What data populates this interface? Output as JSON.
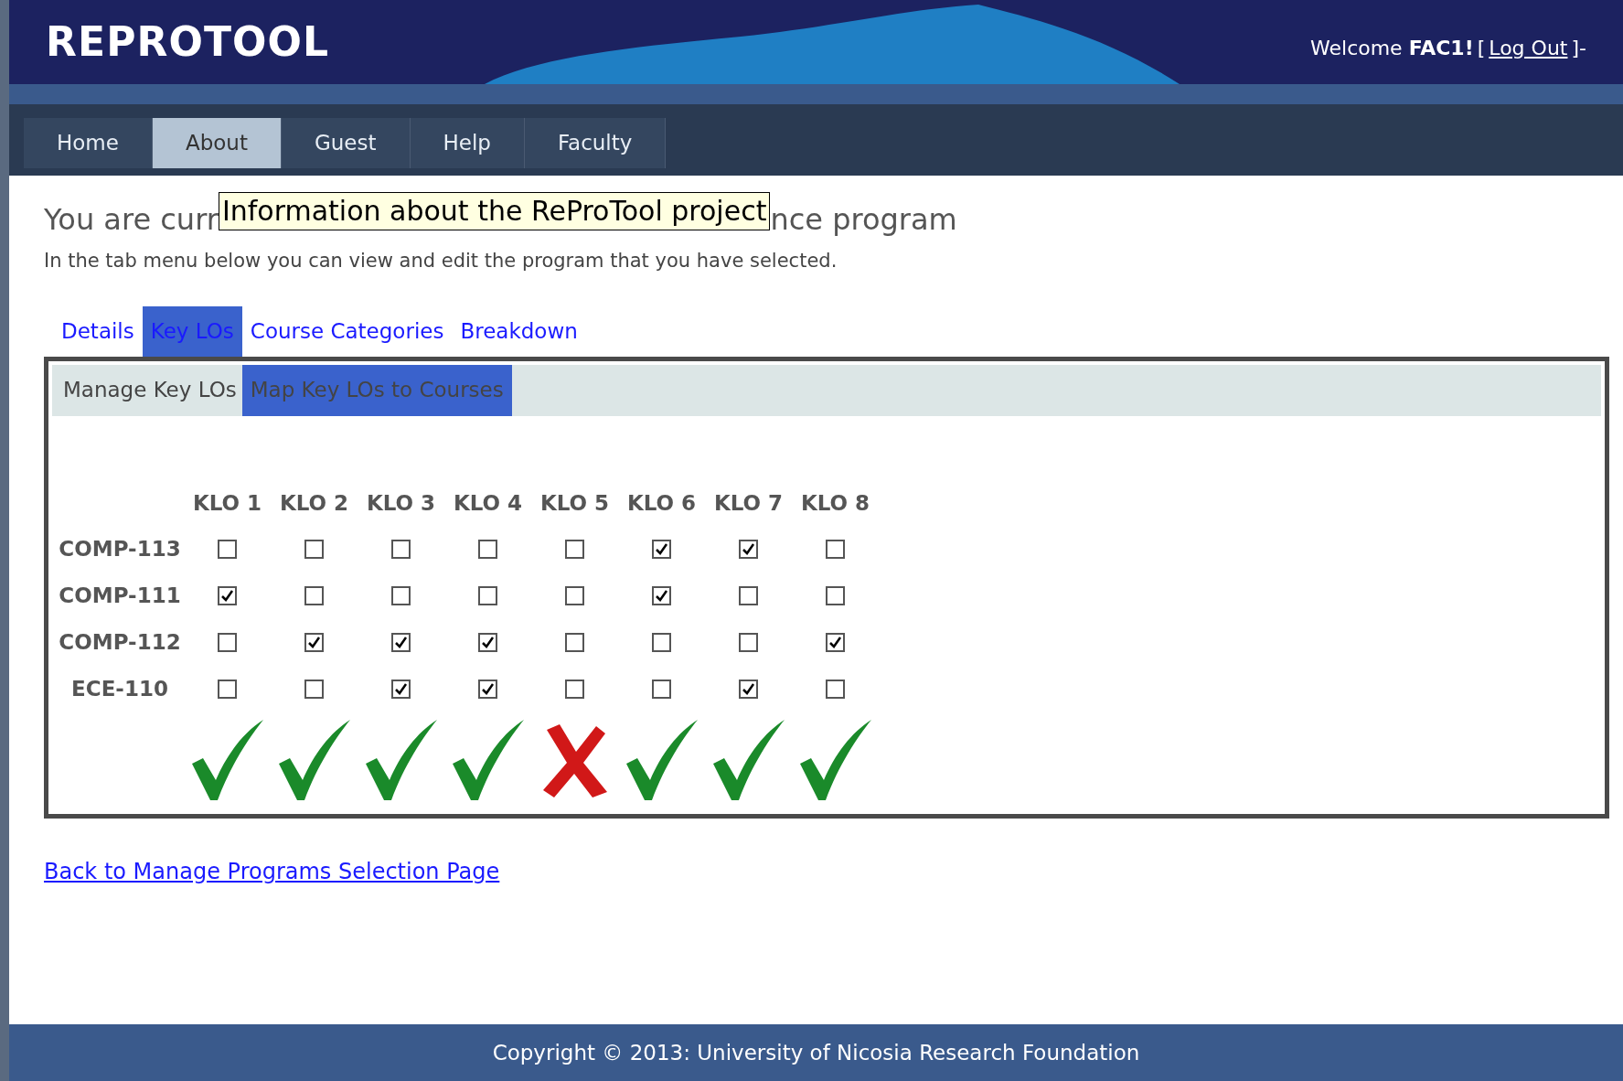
{
  "header": {
    "logo": "REPROTOOL",
    "welcome": "Welcome **FAC1!**",
    "logout_open": "[",
    "logout": "Log Out",
    "logout_close": "]-"
  },
  "nav": [
    {
      "label": "Home",
      "selected": false
    },
    {
      "label": "About",
      "selected": true
    },
    {
      "label": "Guest",
      "selected": false
    },
    {
      "label": "Help",
      "selected": false
    },
    {
      "label": "Faculty",
      "selected": false
    }
  ],
  "tooltip": "Information about the ReProTool project",
  "heading_start": "You are curr",
  "heading_end": "nce program",
  "intro": "In the tab menu below you can view and edit the program that you have selected.",
  "tabs": [
    {
      "label": "Details",
      "selected": false
    },
    {
      "label": "Key LOs",
      "selected": true
    },
    {
      "label": "Course Categories",
      "selected": false
    },
    {
      "label": "Breakdown",
      "selected": false
    }
  ],
  "subtabs": [
    {
      "label": "Manage Key LOs",
      "selected": false
    },
    {
      "label": "Map Key LOs to Courses",
      "selected": true
    }
  ],
  "klos": [
    {
      "label": "KLO 1",
      "mapped": true
    },
    {
      "label": "KLO 2",
      "mapped": true
    },
    {
      "label": "KLO 3",
      "mapped": true
    },
    {
      "label": "KLO 4",
      "mapped": true
    },
    {
      "label": "KLO 5",
      "mapped": false
    },
    {
      "label": "KLO 6",
      "mapped": true
    },
    {
      "label": "KLO 7",
      "mapped": true
    },
    {
      "label": "KLO 8",
      "mapped": true
    }
  ],
  "courses": [
    {
      "code": "COMP-113",
      "checks": [
        false,
        false,
        false,
        false,
        false,
        true,
        true,
        false
      ]
    },
    {
      "code": "COMP-111",
      "checks": [
        true,
        false,
        false,
        false,
        false,
        true,
        false,
        false
      ]
    },
    {
      "code": "COMP-112",
      "checks": [
        false,
        true,
        true,
        true,
        false,
        false,
        false,
        true
      ]
    },
    {
      "code": "ECE-110",
      "checks": [
        false,
        false,
        true,
        true,
        false,
        false,
        true,
        false
      ]
    }
  ],
  "back_link": "Back to Manage Programs Selection Page",
  "footer": "Copyright © 2013: University of Nicosia Research Foundation"
}
